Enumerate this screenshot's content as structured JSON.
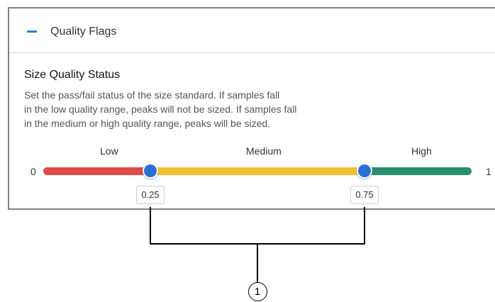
{
  "section": {
    "title": "Quality Flags",
    "collapse_icon": "minus-icon",
    "accent_color": "#1b84d6"
  },
  "size_quality": {
    "title": "Size Quality Status",
    "description_lines": [
      "Set the pass/fail status of the size standard. If samples fall",
      "in the low quality range, peaks will not be sized. If samples fall",
      "in the medium or high quality range, peaks will be sized."
    ]
  },
  "slider": {
    "min_label": "0",
    "max_label": "1",
    "min": 0,
    "max": 1,
    "ranges": [
      {
        "label": "Low",
        "color": "#e04b47"
      },
      {
        "label": "Medium",
        "color": "#f0c233"
      },
      {
        "label": "High",
        "color": "#27906e"
      }
    ],
    "low_threshold": 0.25,
    "high_threshold": 0.75,
    "low_value_text": "0.25",
    "high_value_text": "0.75",
    "thumb_color": "#2a6fd6"
  },
  "callout": {
    "number": "1"
  }
}
